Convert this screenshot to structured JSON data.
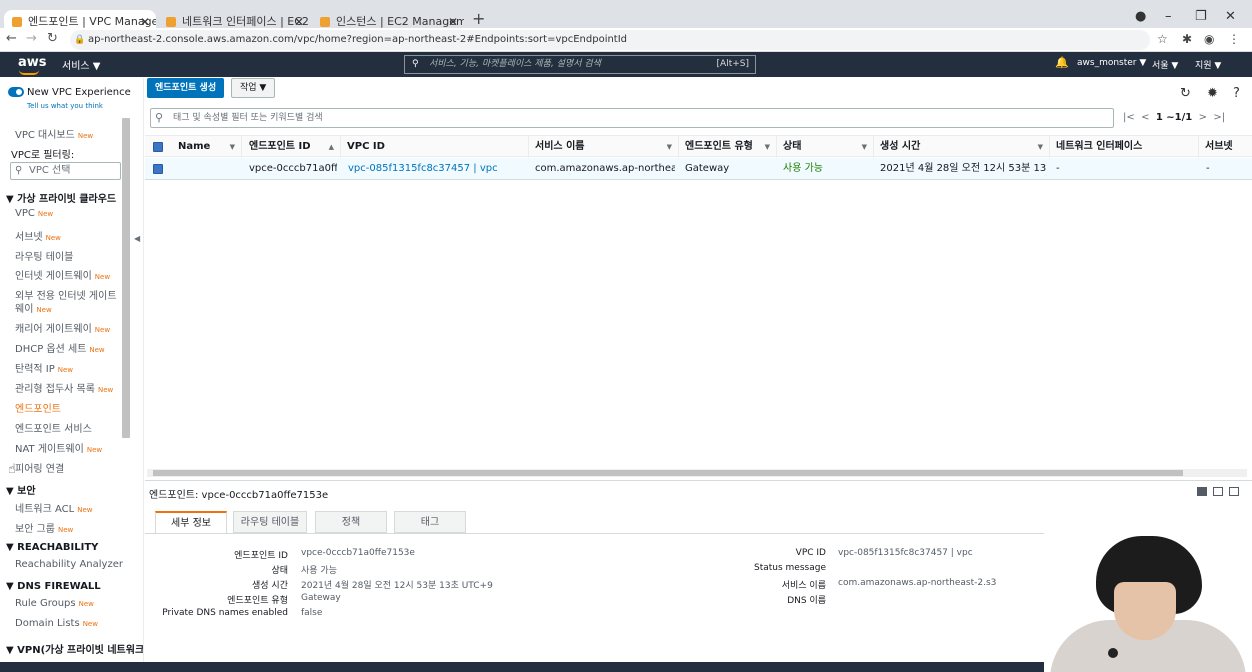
{
  "browser": {
    "tabs": [
      {
        "title": "엔드포인트 | VPC Managem"
      },
      {
        "title": "네트워크 인터페이스 | EC2"
      },
      {
        "title": "인스턴스 | EC2 Manageme"
      }
    ],
    "url": "ap-northeast-2.console.aws.amazon.com/vpc/home?region=ap-northeast-2#Endpoints:sort=vpcEndpointId"
  },
  "aws_header": {
    "logo": "aws",
    "services": "서비스 ▼",
    "search_placeholder": "서비스, 기능, 마켓플레이스 제품, 설명서 검색",
    "search_shortcut": "[Alt+S]",
    "account": "aws_monster ▼",
    "region": "서울 ▼",
    "support": "지원 ▼"
  },
  "sidebar": {
    "new_vpc_experience": "New VPC Experience",
    "tell_us": "Tell us what you think",
    "dashboard": "VPC 대시보드",
    "filter_label": "VPC로 필터링:",
    "vpc_select_placeholder": "VPC 선택",
    "new_badge": "New",
    "section_vpc": "▼ 가상 프라이빗 클라우드",
    "vpc_items": [
      {
        "label": "VPC",
        "new": true
      },
      {
        "label": "서브넷",
        "new": true
      },
      {
        "label": "라우팅 테이블",
        "new": false
      },
      {
        "label": "인터넷 게이트웨이",
        "new": true
      },
      {
        "label": "외부 전용 인터넷 게이트",
        "new": false
      },
      {
        "label": "웨이",
        "new": true
      },
      {
        "label": "캐리어 게이트웨이",
        "new": true
      },
      {
        "label": "DHCP 옵션 세트",
        "new": true
      },
      {
        "label": "탄력적 IP",
        "new": true
      },
      {
        "label": "관리형 접두사 목록",
        "new": true
      },
      {
        "label": "엔드포인트",
        "new": false,
        "active": true
      },
      {
        "label": "엔드포인트 서비스",
        "new": false
      },
      {
        "label": "NAT 게이트웨이",
        "new": true
      },
      {
        "label": "피어링 연결",
        "new": false
      }
    ],
    "section_security": "▼ 보안",
    "security_items": [
      {
        "label": "네트워크 ACL",
        "new": true
      },
      {
        "label": "보안 그룹",
        "new": true
      }
    ],
    "section_reachability": "▼ REACHABILITY",
    "reachability_items": [
      {
        "label": "Reachability Analyzer"
      }
    ],
    "section_dns": "▼ DNS FIREWALL",
    "dns_items": [
      {
        "label": "Rule Groups",
        "new": true
      },
      {
        "label": "Domain Lists",
        "new": true
      }
    ],
    "section_vpn": "▼ VPN(가상 프라이빗 네트워크)"
  },
  "toolbar": {
    "create_endpoint": "엔드포인트 생성",
    "actions": "작업 ▼",
    "filter_placeholder": "태그 및 속성별 필터 또는 키워드별 검색",
    "pagination": "1 ~1/1"
  },
  "table": {
    "columns": [
      "Name",
      "엔드포인트 ID",
      "VPC ID",
      "서비스 이름",
      "엔드포인트 유형",
      "상태",
      "생성 시간",
      "네트워크 인터페이스",
      "서브넷"
    ],
    "rows": [
      {
        "name": "",
        "endpoint_id": "vpce-0cccb71a0ff...",
        "vpc_id": "vpc-085f1315fc8c37457 | vpc",
        "service_name": "com.amazonaws.ap-northeast-...",
        "type": "Gateway",
        "status": "사용 가능",
        "created": "2021년 4월 28일 오전 12시 53분 13...",
        "network_interface": "-",
        "subnet": "-"
      }
    ]
  },
  "detail": {
    "title": "엔드포인트: vpce-0cccb71a0ffe7153e",
    "tabs": [
      "세부 정보",
      "라우팅 테이블",
      "정책",
      "태그"
    ],
    "left": [
      {
        "label": "엔드포인트 ID",
        "value": "vpce-0cccb71a0ffe7153e"
      },
      {
        "label": "상태",
        "value": "사용 가능"
      },
      {
        "label": "생성 시간",
        "value": "2021년 4월 28일 오전 12시 53분 13초 UTC+9"
      },
      {
        "label": "엔드포인트 유형",
        "value": "Gateway"
      },
      {
        "label": "Private DNS names enabled",
        "value": "false"
      }
    ],
    "right": [
      {
        "label": "VPC ID",
        "value": "vpc-085f1315fc8c37457 | vpc"
      },
      {
        "label": "Status message",
        "value": ""
      },
      {
        "label": "서비스 이름",
        "value": "com.amazonaws.ap-northeast-2.s3"
      },
      {
        "label": "DNS 이름",
        "value": ""
      }
    ]
  },
  "colors": {
    "accent": "#0073bb",
    "nav_bg": "#232f3e",
    "orange": "#ec7211",
    "success": "#1d8102"
  }
}
